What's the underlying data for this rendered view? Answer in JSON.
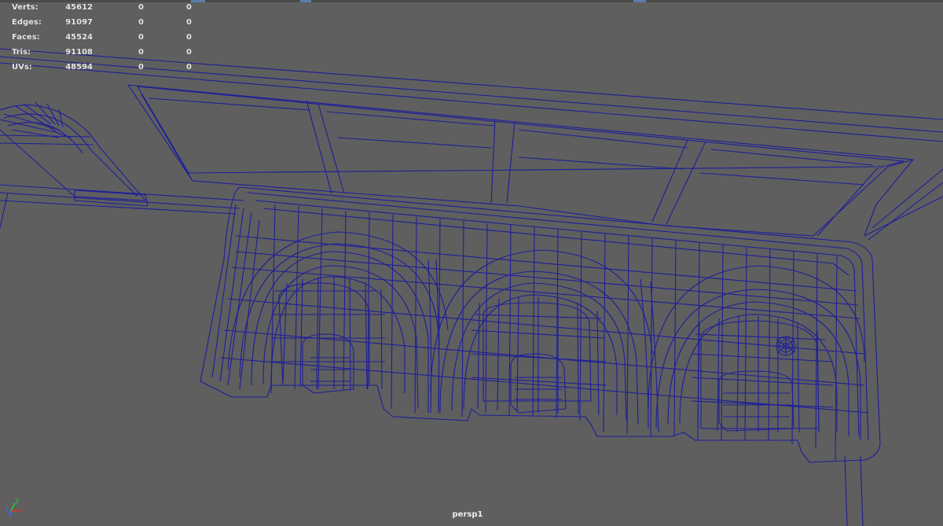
{
  "viewport": {
    "camera": "persp1",
    "background": "#5f5f5f",
    "wireframe_color": "#1e1e9a"
  },
  "hud": {
    "rows": [
      {
        "label": "Verts:",
        "v1": "45612",
        "v2": "0",
        "v3": "0"
      },
      {
        "label": "Edges:",
        "v1": "91097",
        "v2": "0",
        "v3": "0"
      },
      {
        "label": "Faces:",
        "v1": "45524",
        "v2": "0",
        "v3": "0"
      },
      {
        "label": "Tris:",
        "v1": "91108",
        "v2": "0",
        "v3": "0"
      },
      {
        "label": "UVs:",
        "v1": "48594",
        "v2": "0",
        "v3": "0"
      }
    ]
  },
  "axis_gizmo": {
    "x_label": "x",
    "y_label": "y",
    "z_label": "z",
    "x_color": "#e03030",
    "y_color": "#30d030",
    "z_color": "#3a6bff"
  }
}
